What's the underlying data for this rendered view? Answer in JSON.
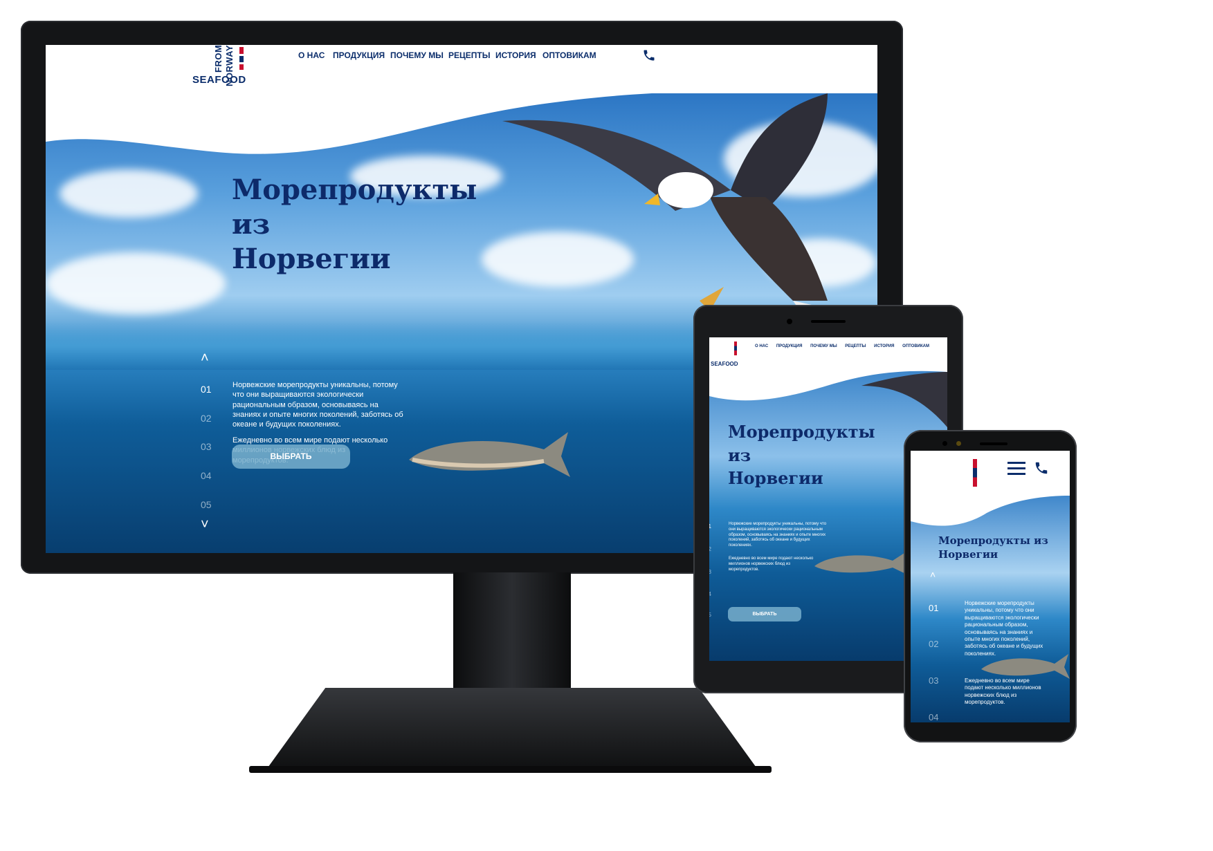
{
  "brand": {
    "word1": "SEAFOOD",
    "word2": "FROM",
    "word3": "NORWAY",
    "flag_colors": [
      "#0b2d6b",
      "#ffffff",
      "#c8102e"
    ]
  },
  "nav": {
    "items": [
      "О НАС",
      "ПРОДУКЦИЯ",
      "ПОЧЕМУ МЫ",
      "РЕЦЕПТЫ",
      "ИСТОРИЯ",
      "ОПТОВИКАМ"
    ],
    "phone_icon": "phone-icon",
    "menu_icon": "hamburger-icon"
  },
  "hero": {
    "title_line1": "Морепродукты",
    "title_line2": "из",
    "title_line3": "Норвегии",
    "title_mobile_line1": "Морепродукты из",
    "title_mobile_line2": "Норвегии",
    "paragraph1": "Норвежские морепродукты уникальны, потому что они выращиваются экологически рациональным образом, основываясь на знаниях и опыте многих поколений, заботясь об океане и будущих поколениях.",
    "paragraph2": "Ежедневно во всем мире подают несколько миллионов норвежских блюд из морепродуктов.",
    "button": "ВЫБРАТЬ"
  },
  "slides": {
    "numbers": [
      "01",
      "02",
      "03",
      "04",
      "05"
    ],
    "active_index": 0
  },
  "colors": {
    "brand_navy": "#0b2d6b",
    "button": "#78afcd",
    "accent_red": "#c8102e"
  }
}
